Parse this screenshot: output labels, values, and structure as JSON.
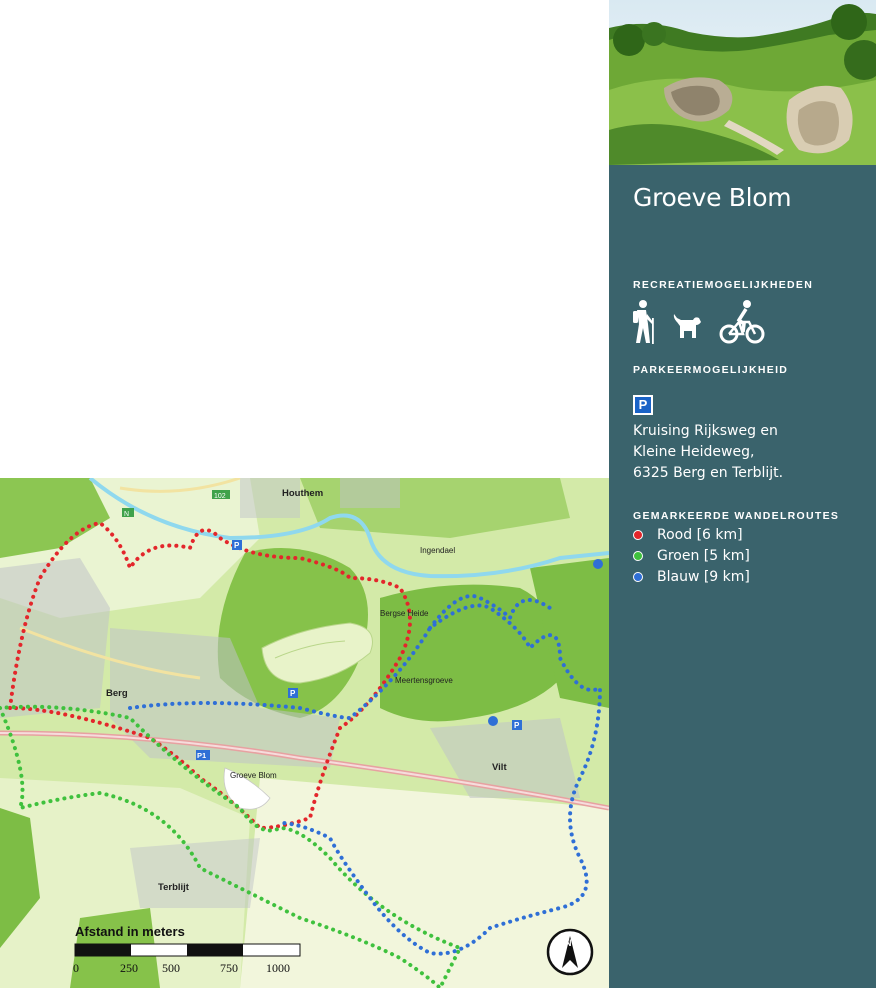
{
  "title": "Groeve Blom",
  "sections": {
    "recreation": "Recreatiemogelijkheden",
    "parking": "Parkeermogelijkheid",
    "routes": "Gemarkeerde wandelroutes"
  },
  "recreation_icons": [
    "hiker-icon",
    "dog-icon",
    "cyclist-icon"
  ],
  "parking_icon": "parking-icon",
  "parking_icon_text": "P",
  "address": [
    "Kruising Rijksweg en",
    "Kleine Heideweg,",
    "6325 Berg en Terblijt."
  ],
  "routes": [
    {
      "label": "Rood [6 km]",
      "color": "#e3262b"
    },
    {
      "label": "Groen [5 km]",
      "color": "#3fc13d"
    },
    {
      "label": "Blauw [9 km]",
      "color": "#2f6fd6"
    }
  ],
  "map": {
    "places": {
      "houthem": "Houthem",
      "ingendael": "Ingendael",
      "bergse_heide": "Bergse Heide",
      "meertensgroeve": "Meertensgroeve",
      "berg": "Berg",
      "vilt": "Vilt",
      "groeve_blom": "Groeve Blom",
      "terblijt": "Terblijt"
    },
    "parking_markers": [
      "P",
      "P",
      "P",
      "P1"
    ],
    "road_badges": [
      "102",
      "N"
    ],
    "scale": {
      "title": "Afstand in meters",
      "ticks": [
        "0",
        "250",
        "500",
        "750",
        "1000"
      ]
    },
    "north_symbol": "N"
  },
  "colors": {
    "panel": "#3a636c",
    "map_light": "#c9e59a",
    "map_forest": "#7fbf44",
    "river": "#8fd8ee"
  }
}
